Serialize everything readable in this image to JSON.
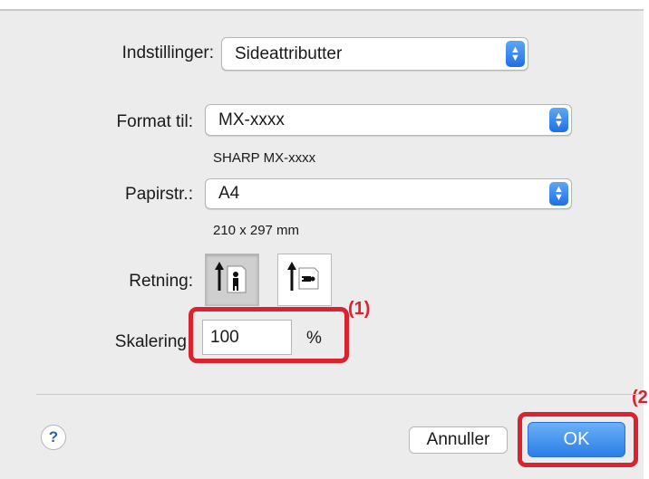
{
  "settings": {
    "label": "Indstillinger:",
    "value": "Sideattributter"
  },
  "format": {
    "label": "Format til:",
    "value": "MX-xxxx",
    "subtext": "SHARP MX-xxxx"
  },
  "paper": {
    "label": "Papirstr.:",
    "value": "A4",
    "subtext": "210 x 297 mm"
  },
  "orientation": {
    "label": "Retning:",
    "options": [
      "portrait-icon",
      "landscape-icon"
    ],
    "selected": "portrait-icon"
  },
  "scale": {
    "label": "Skalering",
    "value": "100",
    "unit": "%"
  },
  "callouts": {
    "c1": "(1)",
    "c2": "(2"
  },
  "footer": {
    "help": "?",
    "cancel": "Annuller",
    "ok": "OK"
  },
  "colors": {
    "accent": "#2a7ee8",
    "highlight": "#d9232f"
  }
}
